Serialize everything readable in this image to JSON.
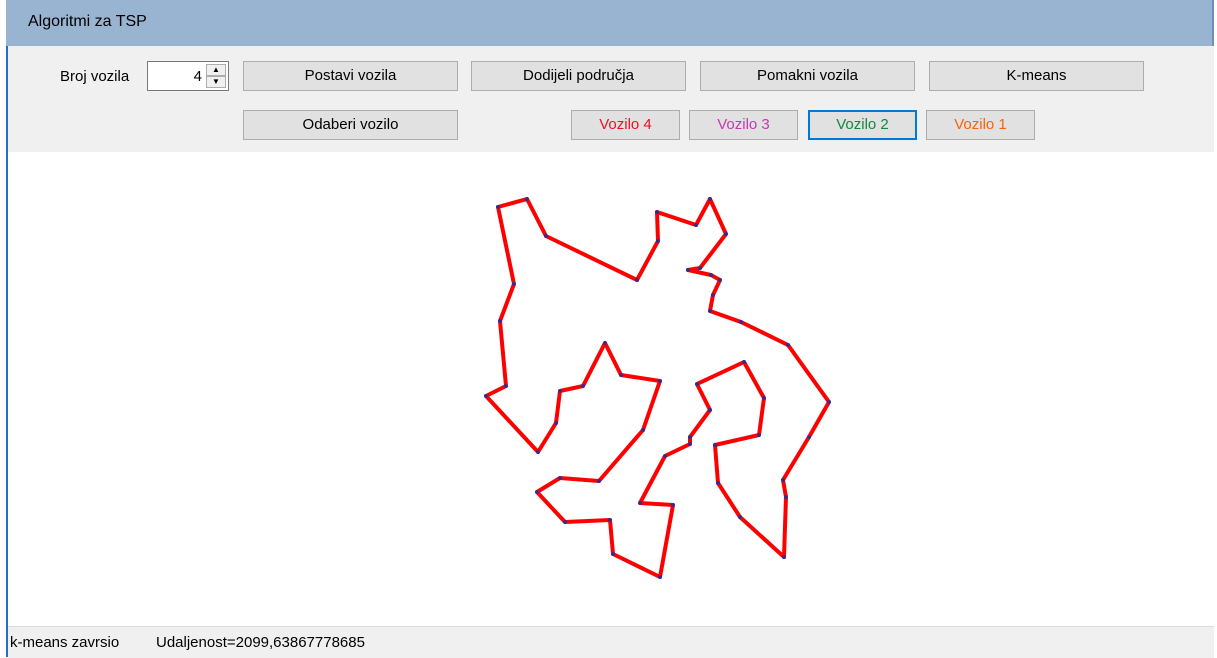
{
  "window": {
    "title": "Algoritmi za TSP"
  },
  "toolbar": {
    "vehicles_label": "Broj vozila",
    "vehicles_count": "4",
    "buttons": {
      "set_vehicles": "Postavi vozila",
      "assign_areas": "Dodijeli područja",
      "move_vehicles": "Pomakni vozila",
      "kmeans": "K-means",
      "select_vehicle": "Odaberi vozilo"
    },
    "vehicle_buttons": [
      {
        "label": "Vozilo 4",
        "color": "#e81123"
      },
      {
        "label": "Vozilo 3",
        "color": "#c239b3"
      },
      {
        "label": "Vozilo 2",
        "color": "#10893e"
      },
      {
        "label": "Vozilo 1",
        "color": "#f7630c"
      }
    ]
  },
  "route": {
    "color": "#ff0000",
    "point_color": "#3b2a8c"
  },
  "status": {
    "message": "k-means zavrsio",
    "distance": "Udaljenost=2099,63867778685"
  }
}
